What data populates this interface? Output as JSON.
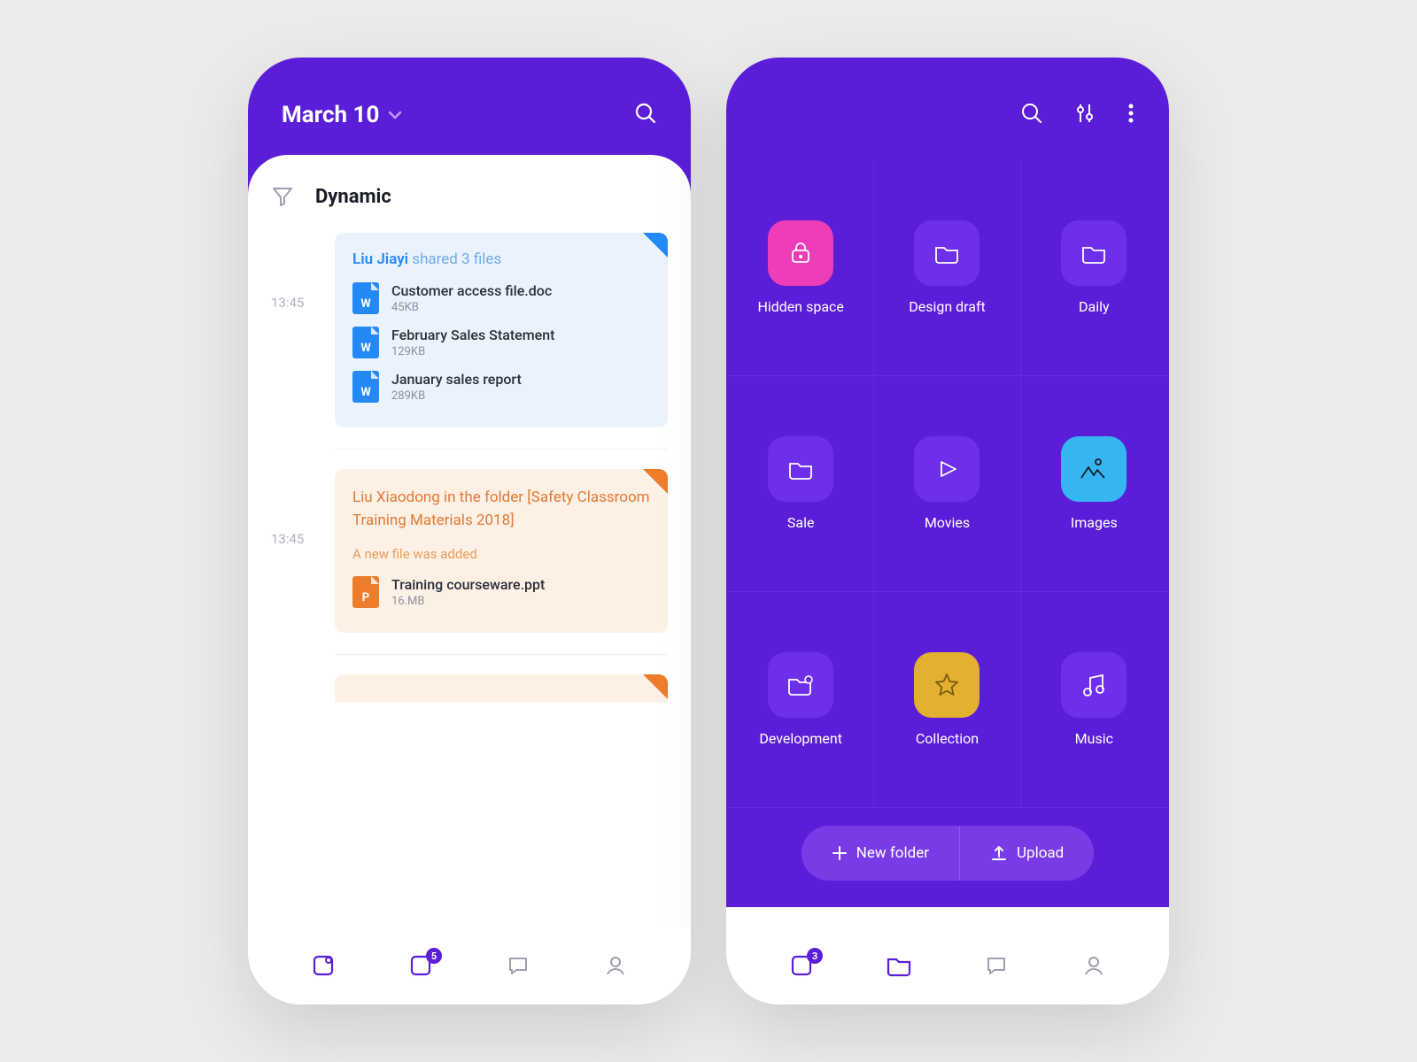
{
  "left": {
    "date": "March 10",
    "sectionTitle": "Dynamic",
    "events": [
      {
        "time": "13:45",
        "user": "Liu Jiayi",
        "actionText": "shared 3 files",
        "files": [
          {
            "name": "Customer access file.doc",
            "size": "45KB",
            "type": "W"
          },
          {
            "name": "February Sales Statement",
            "size": "129KB",
            "type": "W"
          },
          {
            "name": "January sales report",
            "size": "289KB",
            "type": "W"
          }
        ]
      },
      {
        "time": "13:45",
        "headline": "Liu Xiaodong in the folder [Safety Classroom Training Materials 2018]",
        "subtext": "A new file was added",
        "files": [
          {
            "name": "Training courseware.ppt",
            "size": "16.MB",
            "type": "P"
          }
        ]
      }
    ],
    "tabs": {
      "badge2": "5"
    }
  },
  "right": {
    "folders": [
      {
        "label": "Hidden space",
        "icon": "lock",
        "color": "pink"
      },
      {
        "label": "Design draft",
        "icon": "folder",
        "color": "purple"
      },
      {
        "label": "Daily",
        "icon": "folder",
        "color": "purple"
      },
      {
        "label": "Sale",
        "icon": "folder",
        "color": "purple"
      },
      {
        "label": "Movies",
        "icon": "play",
        "color": "purple"
      },
      {
        "label": "Images",
        "icon": "image",
        "color": "cyan"
      },
      {
        "label": "Development",
        "icon": "folder-gear",
        "color": "purple"
      },
      {
        "label": "Collection",
        "icon": "star",
        "color": "gold"
      },
      {
        "label": "Music",
        "icon": "music",
        "color": "purple"
      }
    ],
    "actions": {
      "newFolder": "New folder",
      "upload": "Upload"
    },
    "tabs": {
      "badge1": "3"
    }
  }
}
